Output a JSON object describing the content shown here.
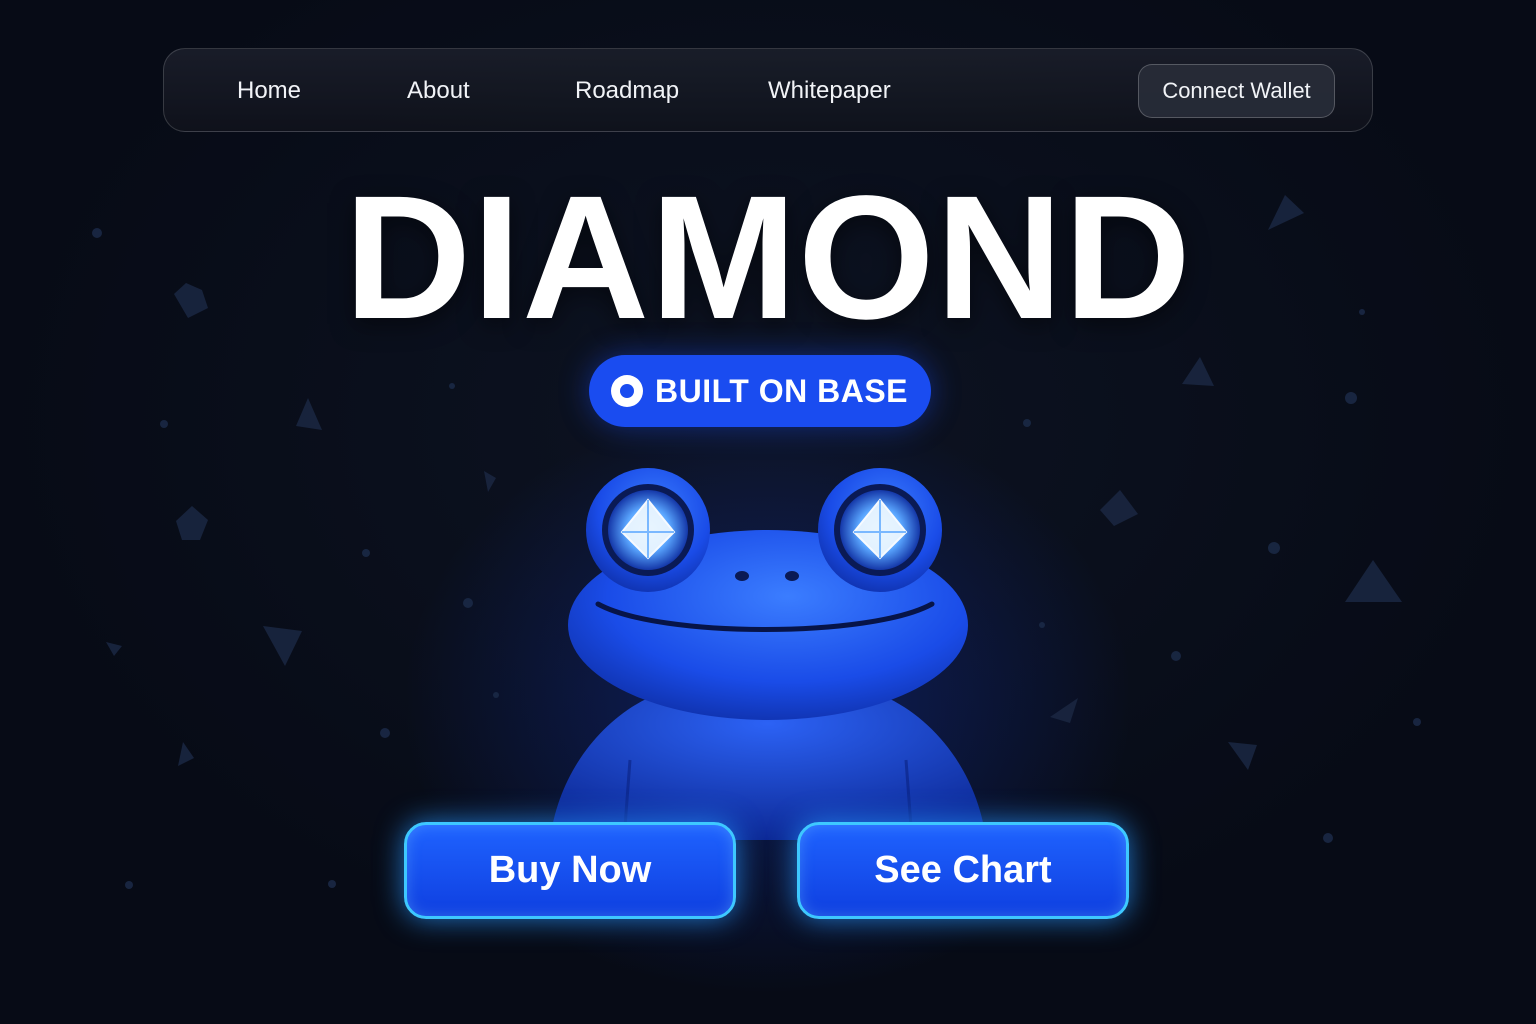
{
  "nav": {
    "links": [
      {
        "label": "Home"
      },
      {
        "label": "About"
      },
      {
        "label": "Roadmap"
      },
      {
        "label": "Whitepaper"
      }
    ],
    "connect_wallet_label": "Connect Wallet"
  },
  "hero": {
    "title": "DIAMOND",
    "badge_label": "BUILT ON BASE",
    "badge_icon": "base-logo-icon",
    "mascot": "diamond-eyed-blue-frog"
  },
  "actions": {
    "buy_label": "Buy Now",
    "chart_label": "See Chart"
  },
  "colors": {
    "background": "#070b16",
    "accent_blue": "#1a4cf0",
    "button_glow": "#3ec8ff",
    "text": "#ffffff"
  }
}
